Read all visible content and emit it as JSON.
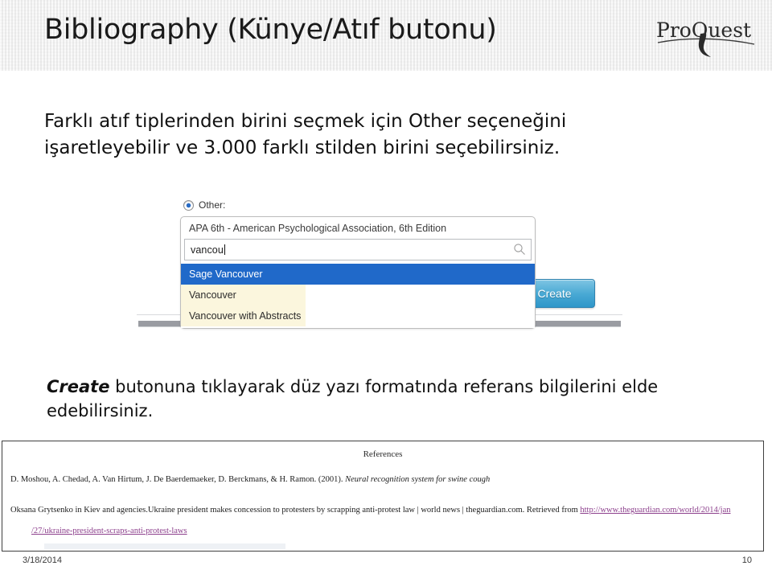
{
  "header": {
    "title": "Bibliography (Künye/Atıf butonu)",
    "logo_text": "ProQuest",
    "logo_name": "proquest-logo"
  },
  "intro": {
    "line1": "Farklı atıf tiplerinden birini seçmek için Other seçeneğini",
    "line2": "işaretleyebilir ve 3.000 farklı stilden birini seçebilirsiniz."
  },
  "screenshot": {
    "radio_label": "Other:",
    "radio_selected": true,
    "combo_selected_value": "APA 6th - American Psychological Association, 6th Edition",
    "search_value": "vancou",
    "search_icon": "magnifier-icon",
    "options": [
      {
        "label": "Sage Vancouver",
        "highlighted": true
      },
      {
        "label": "Vancouver",
        "highlighted": false
      },
      {
        "label": "Vancouver with Abstracts",
        "highlighted": false
      }
    ],
    "create_button_label": "Create",
    "highlight_color": "#2069c9",
    "button_color": "#49a9d4"
  },
  "outro": {
    "emphasis": "Create",
    "rest": " butonuna tıklayarak düz yazı formatında referans bilgilerini elde edebilirsiniz."
  },
  "references": {
    "title": "References",
    "entry1_plain": "D. Moshou, A. Chedad, A. Van Hirtum, J. De Baerdemaeker, D. Berckmans, & H. Ramon. (2001). ",
    "entry1_italic": "Neural recognition system for swine cough",
    "entry2_plain": "Oksana Grytsenko in Kiev and agencies.Ukraine president makes concession to protesters by scrapping anti-protest law | world news | theguardian.com. Retrieved from ",
    "entry2_link": "http://www.theguardian.com/world/2014/jan",
    "entry2_link_cont": "/27/ukraine-president-scraps-anti-protest-laws",
    "link_color": "#8c3f8c"
  },
  "footer": {
    "date": "3/18/2014",
    "page_number": "10"
  }
}
